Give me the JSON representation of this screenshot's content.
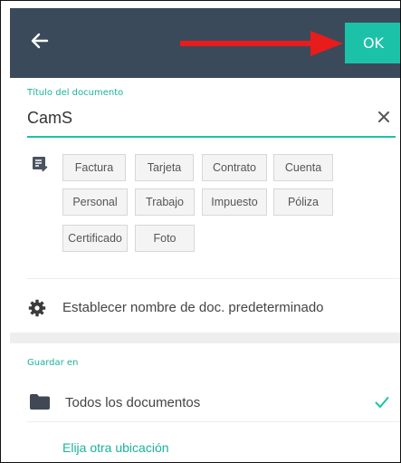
{
  "colors": {
    "topbar": "#3a4a5a",
    "accent": "#1cc2a8",
    "annotation_arrow": "#e81c1c"
  },
  "header": {
    "back_icon": "arrow-left-icon",
    "ok_label": "OK"
  },
  "title_field": {
    "label": "Título del documento",
    "value": "CamS",
    "clear_icon": "close-icon"
  },
  "tags": {
    "icon": "note-edit-icon",
    "items": [
      "Factura",
      "Tarjeta",
      "Contrato",
      "Cuenta",
      "Personal",
      "Trabajo",
      "Impuesto",
      "Póliza",
      "Certificado",
      "Foto"
    ]
  },
  "settings": {
    "icon": "gear-icon",
    "default_name_label": "Establecer nombre de doc. predeterminado"
  },
  "save_in": {
    "label": "Guardar en",
    "folder_icon": "folder-icon",
    "selected_location": "Todos los documentos",
    "check_icon": "check-icon",
    "other_location_link": "Elija otra ubicación"
  }
}
